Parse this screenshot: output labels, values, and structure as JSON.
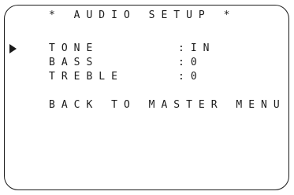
{
  "menu": {
    "title": "* AUDIO SETUP *",
    "items": [
      {
        "label": "TONE",
        "value": ":IN"
      },
      {
        "label": "BASS",
        "value": ":0"
      },
      {
        "label": "TREBLE",
        "value": ":0"
      }
    ],
    "back_label": "BACK TO MASTER MENU",
    "cursor_icon": "right-pointing-triangle-icon"
  }
}
